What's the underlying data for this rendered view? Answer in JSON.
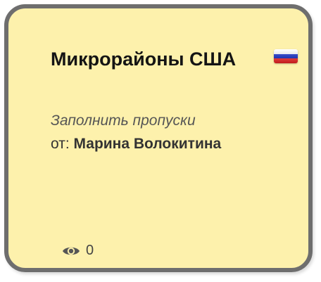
{
  "card": {
    "title": "Микрорайоны США",
    "subtitle": "Заполнить пропуски",
    "author_prefix": "от:",
    "author_name": "Марина Волокитина",
    "flag_icon": "russia-flag-icon",
    "views_icon": "eye-icon",
    "views_count": "0",
    "background_color": "#fdf1ac",
    "border_color": "#6e6e6e"
  }
}
